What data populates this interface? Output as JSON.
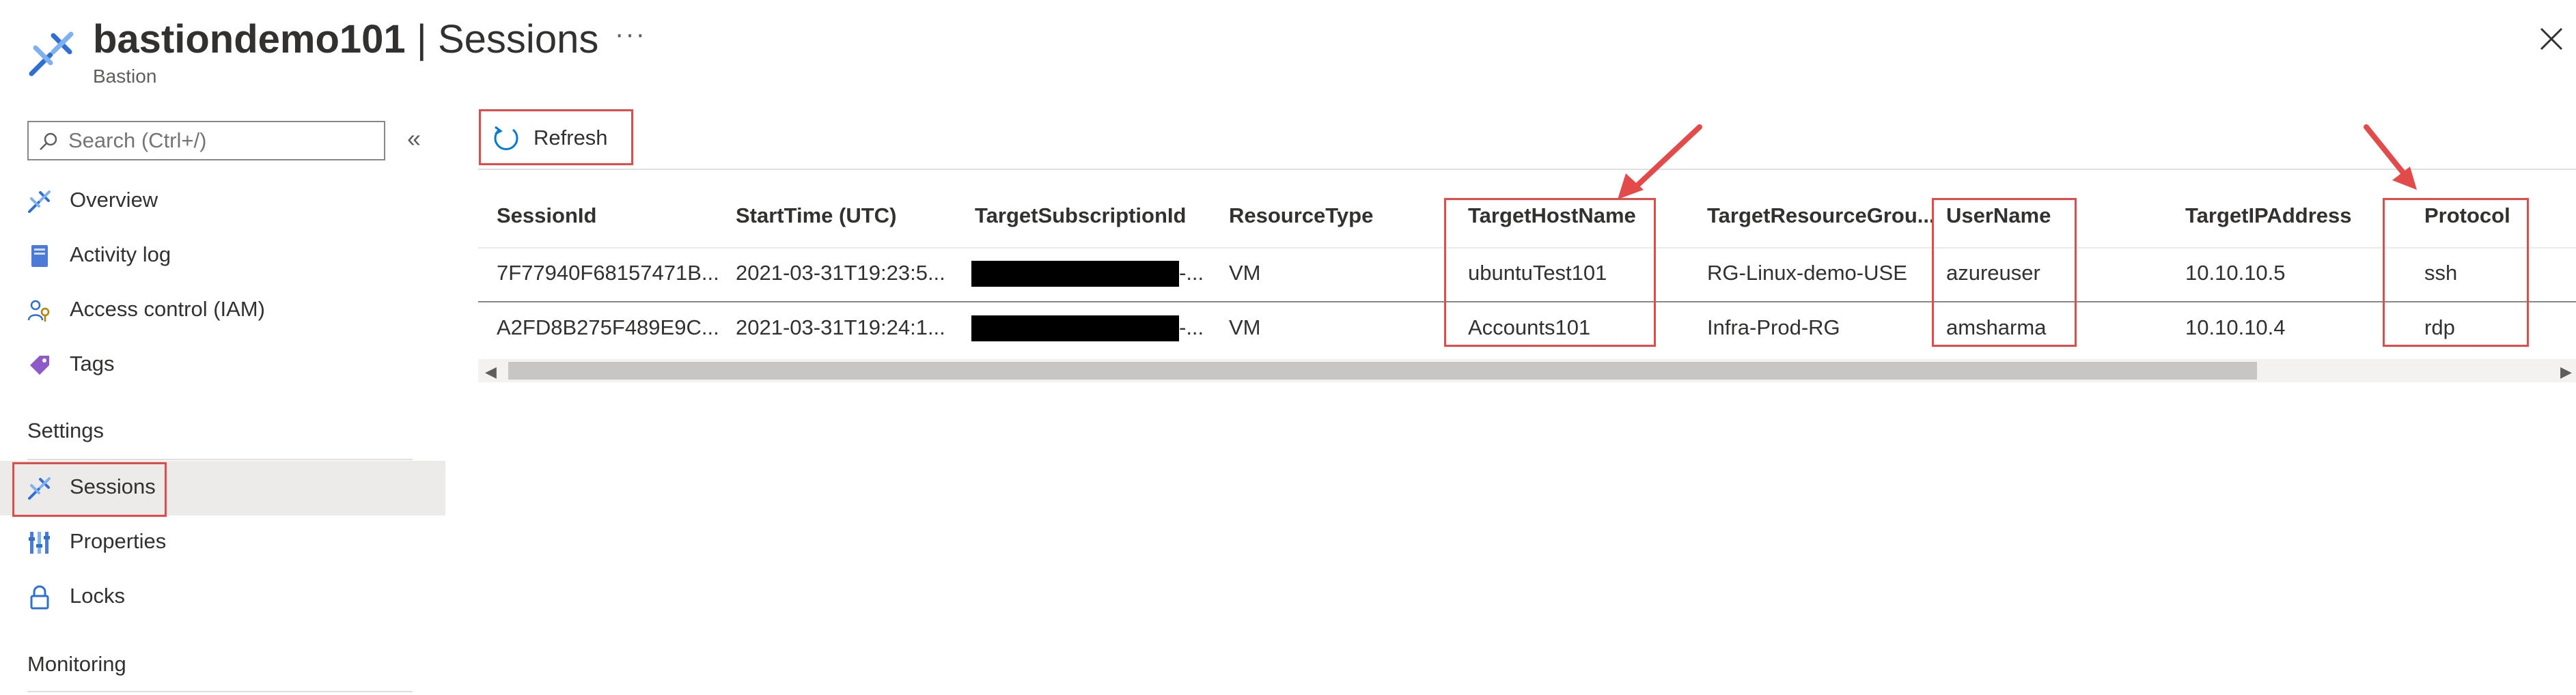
{
  "header": {
    "resource_name": "bastiondemo101",
    "separator": " | ",
    "page_name": "Sessions",
    "resource_type": "Bastion",
    "more_label": "···",
    "close_label": "close"
  },
  "sidebar": {
    "search_placeholder": "Search (Ctrl+/)",
    "collapse_label": "«",
    "items": [
      {
        "label": "Overview",
        "icon": "bastion-icon"
      },
      {
        "label": "Activity log",
        "icon": "activity-log-icon"
      },
      {
        "label": "Access control (IAM)",
        "icon": "iam-icon"
      },
      {
        "label": "Tags",
        "icon": "tag-icon"
      }
    ],
    "settings_title": "Settings",
    "settings_items": [
      {
        "label": "Sessions",
        "icon": "bastion-icon",
        "active": true
      },
      {
        "label": "Properties",
        "icon": "properties-icon"
      },
      {
        "label": "Locks",
        "icon": "lock-icon"
      }
    ],
    "monitoring_title": "Monitoring"
  },
  "toolbar": {
    "refresh_label": "Refresh"
  },
  "table": {
    "columns": [
      "SessionId",
      "StartTime (UTC)",
      "TargetSubscriptionId",
      "ResourceType",
      "TargetHostName",
      "TargetResourceGrou...",
      "UserName",
      "TargetIPAddress",
      "Protocol"
    ],
    "rows": [
      [
        "7F77940F68157471B...",
        "2021-03-31T19:23:5...",
        "-...",
        "VM",
        "ubuntuTest101",
        "RG-Linux-demo-USE",
        "azureuser",
        "10.10.10.5",
        "ssh"
      ],
      [
        "A2FD8B275F489E9C...",
        "2021-03-31T19:24:1...",
        "-...",
        "VM",
        "Accounts101",
        "Infra-Prod-RG",
        "amsharma",
        "10.10.10.4",
        "rdp"
      ]
    ]
  },
  "colors": {
    "accent": "#0078d4",
    "highlight": "#e34b4b",
    "active_bg": "#edebe9"
  }
}
